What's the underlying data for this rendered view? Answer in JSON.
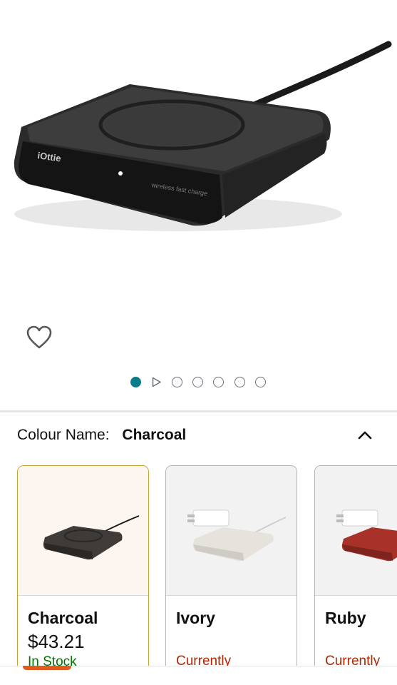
{
  "product": {
    "image_alt": "iOttie wireless charging pad",
    "brand_logo": "iOttie",
    "device_text": "wireless fast charge"
  },
  "gallery": {
    "total_images": 7,
    "current_index": 1
  },
  "icons": {
    "wishlist": "heart-outline-icon",
    "video": "play-triangle-icon",
    "collapse": "chevron-up-icon"
  },
  "colour": {
    "label": "Colour Name:",
    "selected": "Charcoal"
  },
  "swatches": [
    {
      "name": "Charcoal",
      "price": "$43.21",
      "status": "In Stock",
      "color": "#3f3b38",
      "selected": true
    },
    {
      "name": "Ivory",
      "price": "",
      "status": "Currently",
      "color": "#e6e2dc",
      "selected": false
    },
    {
      "name": "Ruby",
      "price": "",
      "status": "Currently",
      "color": "#a8312a",
      "selected": false
    }
  ],
  "colors": {
    "accent_teal": "#087e8b",
    "selected_border": "#c7a531",
    "in_stock": "#007600",
    "unavailable": "#b12704",
    "bottom_accent": "#e15a1e"
  }
}
